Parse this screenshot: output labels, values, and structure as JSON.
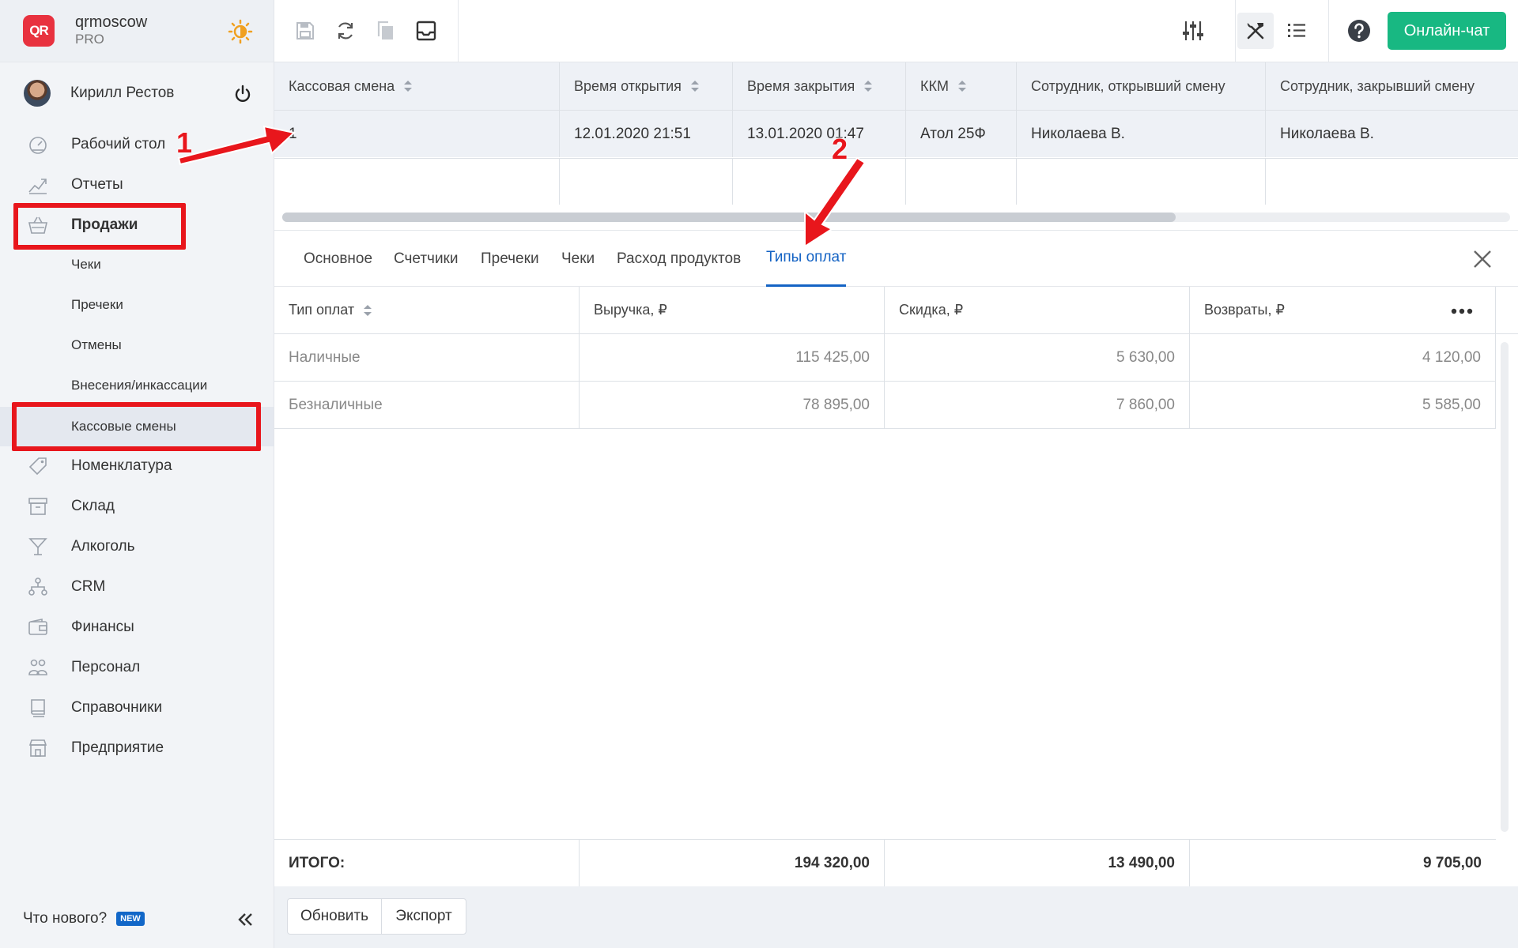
{
  "app": {
    "name": "qrmoscow",
    "plan": "PRO",
    "logo_text": "QR",
    "user_name": "Кирилл Рестов"
  },
  "sidebar": {
    "items": [
      {
        "label": "Рабочий стол",
        "icon": "dashboard-icon"
      },
      {
        "label": "Отчеты",
        "icon": "chart-icon"
      },
      {
        "label": "Продажи",
        "icon": "basket-icon"
      },
      {
        "label": "Чеки"
      },
      {
        "label": "Пречеки"
      },
      {
        "label": "Отмены"
      },
      {
        "label": "Внесения/инкассации"
      },
      {
        "label": "Кассовые смены"
      },
      {
        "label": "Номенклатура",
        "icon": "tag-icon"
      },
      {
        "label": "Склад",
        "icon": "warehouse-icon"
      },
      {
        "label": "Алкоголь",
        "icon": "cocktail-icon"
      },
      {
        "label": "CRM",
        "icon": "crm-icon"
      },
      {
        "label": "Финансы",
        "icon": "wallet-icon"
      },
      {
        "label": "Персонал",
        "icon": "people-icon"
      },
      {
        "label": "Справочники",
        "icon": "book-icon"
      },
      {
        "label": "Предприятие",
        "icon": "store-icon"
      }
    ],
    "whats_new": "Что нового?",
    "new_badge": "NEW"
  },
  "toolbar": {
    "chat_label": "Онлайн-чат"
  },
  "shifts_table": {
    "columns": [
      "Кассовая смена",
      "Время открытия",
      "Время закрытия",
      "ККМ",
      "Сотрудник, открывший смену",
      "Сотрудник, закрывший смену"
    ],
    "rows": [
      [
        "1",
        "12.01.2020 21:51",
        "13.01.2020 01:47",
        "Атол 25Ф",
        "Николаева В.",
        "Николаева В."
      ]
    ]
  },
  "tabs": [
    "Основное",
    "Счетчики",
    "Пречеки",
    "Чеки",
    "Расход продуктов",
    "Типы оплат"
  ],
  "payments_table": {
    "columns": [
      "Тип оплат",
      "Выручка, ₽",
      "Скидка, ₽",
      "Возвраты, ₽"
    ],
    "rows": [
      [
        "Наличные",
        "115 425,00",
        "5 630,00",
        "4 120,00"
      ],
      [
        "Безналичные",
        "78 895,00",
        "7 860,00",
        "5 585,00"
      ]
    ],
    "totals": [
      "ИТОГО:",
      "194 320,00",
      "13 490,00",
      "9 705,00"
    ]
  },
  "footer": {
    "refresh_label": "Обновить",
    "export_label": "Экспорт"
  },
  "annotations": {
    "marker_1": "1",
    "marker_2": "2",
    "color": "#e8161c"
  }
}
